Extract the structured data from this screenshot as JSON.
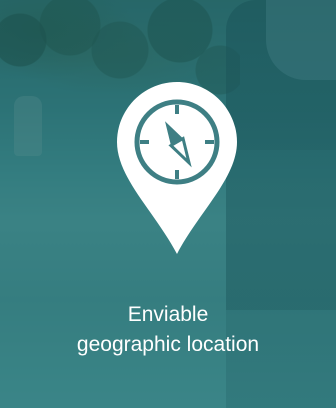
{
  "feature": {
    "title_line1": "Enviable",
    "title_line2": "geographic location"
  },
  "icon": {
    "name": "compass-location-pin-icon",
    "color": "#ffffff"
  },
  "colors": {
    "overlay": "#206e73",
    "text": "#ffffff"
  }
}
